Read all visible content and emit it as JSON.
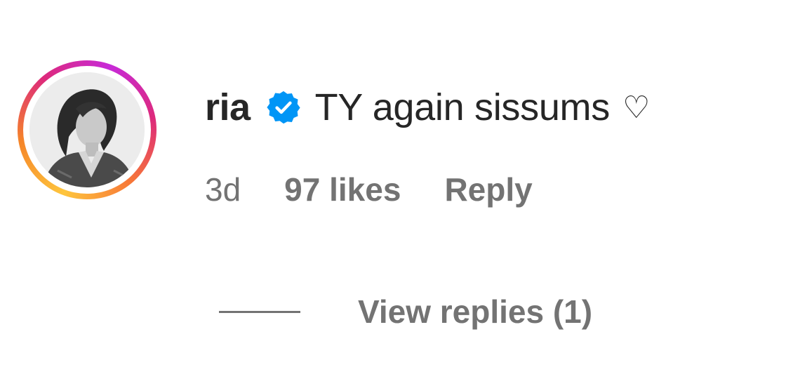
{
  "comment": {
    "username": "ria",
    "verified_icon": "verified-badge-icon",
    "text": "TY again sissums",
    "heart": "♡",
    "time": "3d",
    "likes": "97 likes",
    "reply_label": "Reply",
    "view_replies_label": "View replies (1)"
  },
  "colors": {
    "text_primary": "#262626",
    "text_secondary": "#737373",
    "verified_blue": "#0095f6",
    "story_ring": [
      "#fec53d",
      "#f58529",
      "#dd2a7b",
      "#c72ad8"
    ]
  }
}
